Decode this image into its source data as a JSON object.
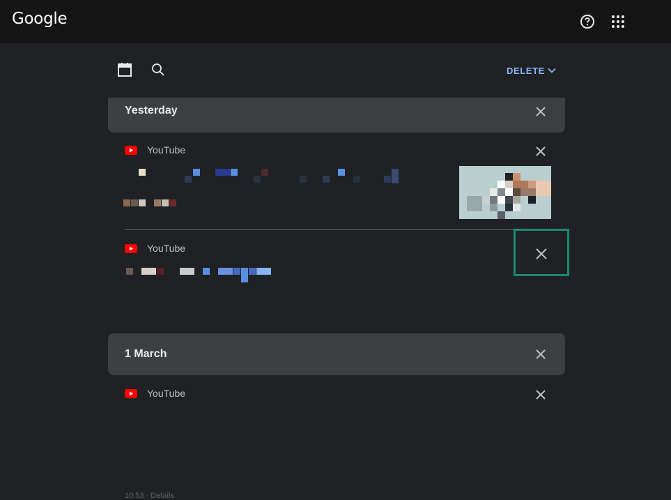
{
  "header": {
    "logo": "Google",
    "help_icon": "help-circle-icon",
    "apps_icon": "apps-grid-icon"
  },
  "toolbar": {
    "calendar_icon": "calendar-icon",
    "search_icon": "search-icon",
    "delete_label": "DELETE"
  },
  "groups": [
    {
      "title": "Yesterday",
      "entries": [
        {
          "source": "YouTube"
        },
        {
          "source": "YouTube"
        }
      ]
    },
    {
      "title": "1 March",
      "entries": [
        {
          "source": "YouTube",
          "meta": "10:53 · Details"
        }
      ]
    }
  ],
  "colors": {
    "background": "#202124",
    "topbar": "#151515",
    "header_card": "#3c4043",
    "accent": "#8ab4f8",
    "youtube_red": "#ff0000",
    "highlight": "#1a8a6e"
  }
}
